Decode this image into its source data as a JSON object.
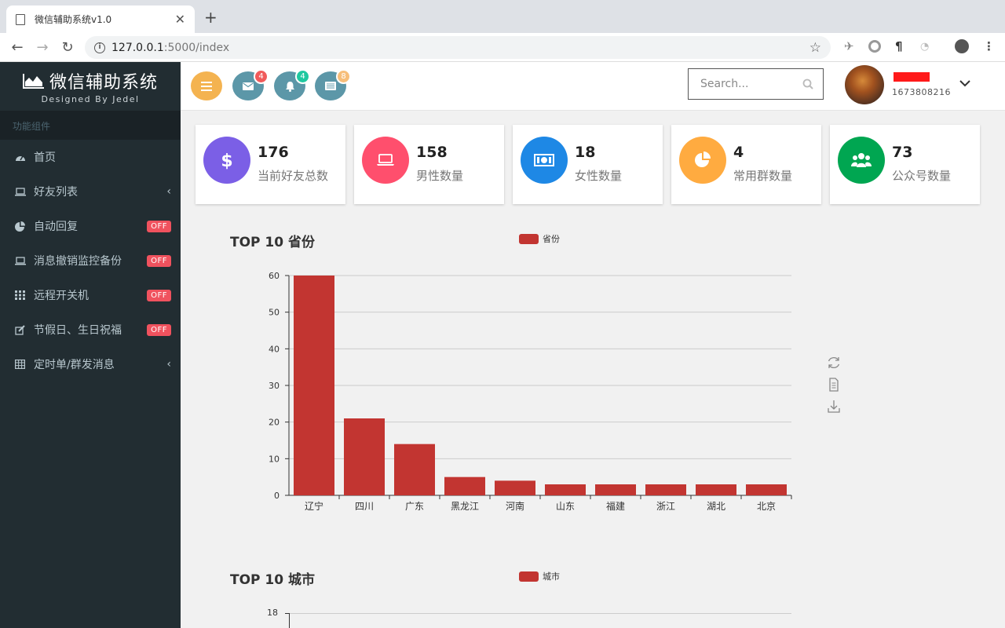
{
  "browser": {
    "tab_title": "微信辅助系统v1.0",
    "url_host": "127.0.0.1",
    "url_path": ":5000/index"
  },
  "sidebar": {
    "brand_title": "微信辅助系统",
    "brand_sub": "Designed By Jedel",
    "section_header": "功能组件",
    "items": [
      {
        "label": "首页",
        "icon": "dashboard-icon"
      },
      {
        "label": "好友列表",
        "icon": "laptop-icon",
        "arrow": "‹"
      },
      {
        "label": "自动回复",
        "icon": "pie-chart-icon",
        "badge": "OFF"
      },
      {
        "label": "消息撤销监控备份",
        "icon": "laptop-icon",
        "badge": "OFF"
      },
      {
        "label": "远程开关机",
        "icon": "grid-icon",
        "badge": "OFF"
      },
      {
        "label": "节假日、生日祝福",
        "icon": "edit-icon",
        "badge": "OFF"
      },
      {
        "label": "定时单/群发消息",
        "icon": "table-icon",
        "arrow": "‹"
      }
    ]
  },
  "header": {
    "mail_count": "4",
    "bell_count": "4",
    "news_count": "8",
    "search_placeholder": "Search...",
    "user_id": "1673808216"
  },
  "stats": [
    {
      "value": "176",
      "label": "当前好友总数",
      "color": "#7b5fe6",
      "icon": "dollar-icon"
    },
    {
      "value": "158",
      "label": "男性数量",
      "color": "#ff4f6d",
      "icon": "laptop-icon"
    },
    {
      "value": "18",
      "label": "女性数量",
      "color": "#1e88e5",
      "icon": "money-icon"
    },
    {
      "value": "4",
      "label": "常用群数量",
      "color": "#ffab40",
      "icon": "pie-chart-icon"
    },
    {
      "value": "73",
      "label": "公众号数量",
      "color": "#00a651",
      "icon": "users-icon"
    }
  ],
  "chart_data": [
    {
      "type": "bar",
      "title": "TOP 10 省份",
      "legend": [
        "省份"
      ],
      "categories": [
        "辽宁",
        "四川",
        "广东",
        "黑龙江",
        "河南",
        "山东",
        "福建",
        "浙江",
        "湖北",
        "北京"
      ],
      "series": [
        {
          "name": "省份",
          "values": [
            60,
            21,
            14,
            5,
            4,
            3,
            3,
            3,
            3,
            3
          ]
        }
      ],
      "ylim": [
        0,
        60
      ],
      "yticks": [
        0,
        10,
        20,
        30,
        40,
        50,
        60
      ],
      "grid": true,
      "color": "#c23531"
    },
    {
      "type": "bar",
      "title": "TOP 10 城市",
      "legend": [
        "城市"
      ],
      "series": [
        {
          "name": "城市",
          "values": []
        }
      ],
      "yticks": [
        18
      ],
      "color": "#c23531"
    }
  ]
}
